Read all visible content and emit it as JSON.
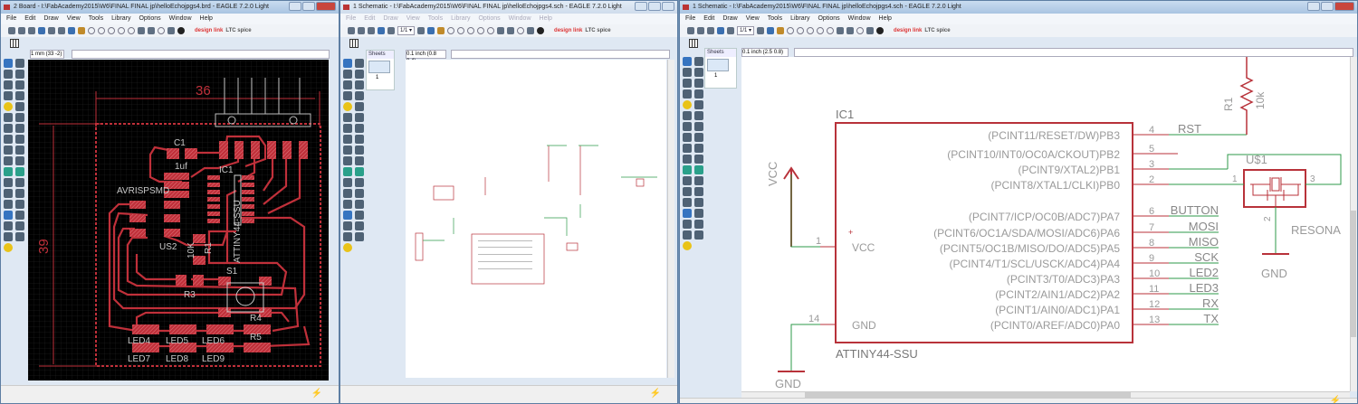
{
  "board_window": {
    "title": "2 Board - I:\\FabAcademy2015\\W6\\FINAL FINAL jp\\helloEchojpgs4.brd - EAGLE 7.2.0 Light",
    "menu": [
      "File",
      "Edit",
      "Draw",
      "View",
      "Tools",
      "Library",
      "Options",
      "Window",
      "Help"
    ],
    "grid_readout": "1 mm (33 -2)",
    "command": "",
    "dim_width": "36",
    "dim_height": "39",
    "labels": {
      "c1": "C1",
      "c1_val": "1uf",
      "ic1": "IC1",
      "ic1_val": "ATTINY44-SSU",
      "avr": "AVRISPSMD",
      "us2": "US2",
      "r1": "R1",
      "r1_val": "10K",
      "s1": "S1",
      "r3": "R3",
      "r4": "R4",
      "r5": "R5",
      "led4": "LED4",
      "led5": "LED5",
      "led6": "LED6",
      "led7": "LED7",
      "led8": "LED8",
      "led9": "LED9"
    },
    "colors": {
      "background": "#000000",
      "copper": "#c0303a",
      "dimension": "#c0303a",
      "silk": "#c8c8c8"
    }
  },
  "small_schematic_window": {
    "title": "1 Schematic - I:\\FabAcademy2015\\W6\\FINAL FINAL jp\\helloEchojpgs4.sch - EAGLE 7.2.0 Light",
    "menu": [
      "File",
      "Edit",
      "Draw",
      "View",
      "Tools",
      "Library",
      "Options",
      "Window",
      "Help"
    ],
    "sheets_label": "Sheets",
    "sheet_number": "1",
    "grid_readout": "0.1 inch (0.8 0.4)",
    "sheet_select": "1/1"
  },
  "schematic_window": {
    "title": "1 Schematic - I:\\FabAcademy2015\\W6\\FINAL FINAL jp\\helloEchojpgs4.sch - EAGLE 7.2.0 Light",
    "menu": [
      "File",
      "Edit",
      "Draw",
      "View",
      "Tools",
      "Library",
      "Options",
      "Window",
      "Help"
    ],
    "sheets_label": "Sheets",
    "sheet_number": "1",
    "grid_readout": "0.1 inch (2.5 0.8)",
    "sheet_select": "1/1",
    "ic_name": "IC1",
    "ic_value": "ATTINY44-SSU",
    "vcc_pin_label": "VCC",
    "gnd_pin_label": "GND",
    "vcc_supply": "VCC",
    "gnd_supply": "GND",
    "gnd_supply2": "GND",
    "vcc_pin_num": "1",
    "gnd_pin_num": "14",
    "pins": [
      {
        "name": "(PCINT11/RESET/DW)PB3",
        "num": "4",
        "net": "RST"
      },
      {
        "name": "(PCINT10/INT0/OC0A/CKOUT)PB2",
        "num": "5",
        "net": ""
      },
      {
        "name": "(PCINT9/XTAL2)PB1",
        "num": "3",
        "net": ""
      },
      {
        "name": "(PCINT8/XTAL1/CLKI)PB0",
        "num": "2",
        "net": ""
      },
      {
        "name": "(PCINT7/ICP/OC0B/ADC7)PA7",
        "num": "6",
        "net": "BUTTON"
      },
      {
        "name": "(PCINT6/OC1A/SDA/MOSI/ADC6)PA6",
        "num": "7",
        "net": "MOSI"
      },
      {
        "name": "(PCINT5/OC1B/MISO/DO/ADC5)PA5",
        "num": "8",
        "net": "MISO"
      },
      {
        "name": "(PCINT4/T1/SCL/USCK/ADC4)PA4",
        "num": "9",
        "net": "SCK"
      },
      {
        "name": "(PCINT3/T0/ADC3)PA3",
        "num": "10",
        "net": "LED2"
      },
      {
        "name": "(PCINT2/AIN1/ADC2)PA2",
        "num": "11",
        "net": "LED3"
      },
      {
        "name": "(PCINT1/AIN0/ADC1)PA1",
        "num": "12",
        "net": "RX"
      },
      {
        "name": "(PCINT0/AREF/ADC0)PA0",
        "num": "13",
        "net": "TX"
      }
    ],
    "r1_name": "R1",
    "r1_value": "10k",
    "resonator_name": "U$1",
    "resonator_value": "RESONA",
    "res_pin1": "1",
    "res_pin2": "2",
    "res_pin3": "3",
    "colors": {
      "symbol": "#b8323a",
      "wire": "#2e9a4a",
      "text": "#9a9a9a"
    }
  },
  "toolbar_icons": [
    "new-icon",
    "save-icon",
    "print-icon",
    "cam-icon",
    "info-icon",
    "layers-icon",
    "board-icon",
    "schematic-icon",
    "zoom-fit-icon",
    "zoom-in-icon",
    "zoom-out-icon",
    "zoom-redraw-icon",
    "zoom-select-icon",
    "undo-icon",
    "redo-icon",
    "stop-icon",
    "go-icon",
    "help-icon"
  ],
  "logos": {
    "designlink": "design link",
    "ltc": "LTC spice"
  }
}
